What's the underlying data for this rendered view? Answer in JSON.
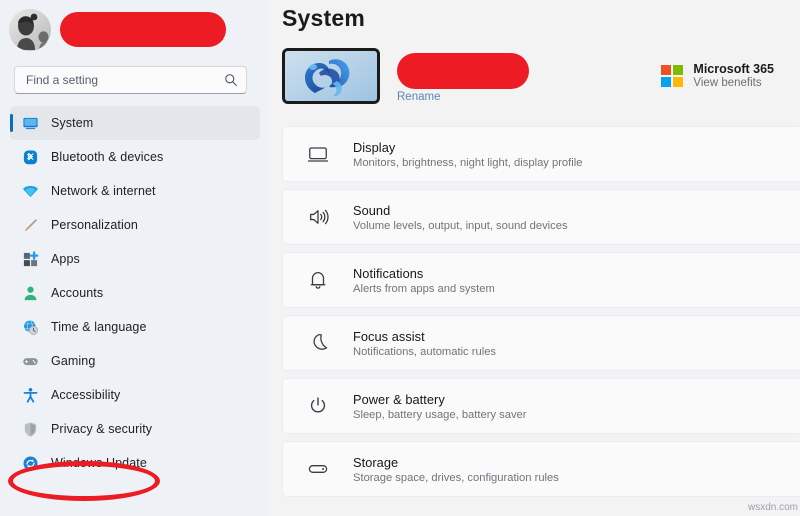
{
  "sidebar": {
    "account": {
      "avatar_icon": "user-photo-avatar",
      "name_redacted": true,
      "redaction_color": "#ed1c24"
    },
    "search": {
      "placeholder": "Find a setting",
      "value": "",
      "icon": "search-icon"
    },
    "items": [
      {
        "label": "System",
        "icon": "monitor-icon",
        "selected": true
      },
      {
        "label": "Bluetooth & devices",
        "icon": "bluetooth-icon",
        "selected": false
      },
      {
        "label": "Network & internet",
        "icon": "wifi-icon",
        "selected": false
      },
      {
        "label": "Personalization",
        "icon": "paintbrush-icon",
        "selected": false
      },
      {
        "label": "Apps",
        "icon": "apps-grid-icon",
        "selected": false
      },
      {
        "label": "Accounts",
        "icon": "person-icon",
        "selected": false
      },
      {
        "label": "Time & language",
        "icon": "clock-globe-icon",
        "selected": false
      },
      {
        "label": "Gaming",
        "icon": "gamepad-icon",
        "selected": false
      },
      {
        "label": "Accessibility",
        "icon": "accessibility-icon",
        "selected": false
      },
      {
        "label": "Privacy & security",
        "icon": "shield-icon",
        "selected": false
      },
      {
        "label": "Windows Update",
        "icon": "update-sync-icon",
        "selected": false
      }
    ],
    "annotation": {
      "shape": "ellipse",
      "target": "Windows Update",
      "color": "#ec1c24"
    }
  },
  "main": {
    "title": "System",
    "device": {
      "thumbnail_icon": "windows-bloom-wallpaper-thumbnail",
      "name_redacted": true,
      "rename_label": "Rename"
    },
    "microsoft365": {
      "title": "Microsoft 365",
      "subtitle": "View benefits",
      "logo_icon": "microsoft-logo-icon",
      "logo_colors": [
        "#f25022",
        "#7fba00",
        "#00a4ef",
        "#ffb900"
      ]
    },
    "cards": [
      {
        "title": "Display",
        "subtitle": "Monitors, brightness, night light, display profile",
        "icon": "monitor-outline-icon"
      },
      {
        "title": "Sound",
        "subtitle": "Volume levels, output, input, sound devices",
        "icon": "speaker-icon"
      },
      {
        "title": "Notifications",
        "subtitle": "Alerts from apps and system",
        "icon": "bell-icon"
      },
      {
        "title": "Focus assist",
        "subtitle": "Notifications, automatic rules",
        "icon": "moon-icon"
      },
      {
        "title": "Power & battery",
        "subtitle": "Sleep, battery usage, battery saver",
        "icon": "power-icon"
      },
      {
        "title": "Storage",
        "subtitle": "Storage space, drives, configuration rules",
        "icon": "drive-icon"
      }
    ]
  },
  "watermark": {
    "text": "wsxdn.com"
  },
  "colors": {
    "accent": "#0f6cbd",
    "sidebar_bg": "#eef1f5",
    "main_bg": "#f3f3f3",
    "card_bg": "#fafafb",
    "redaction": "#ed1c24",
    "link": "#5a87b8"
  }
}
